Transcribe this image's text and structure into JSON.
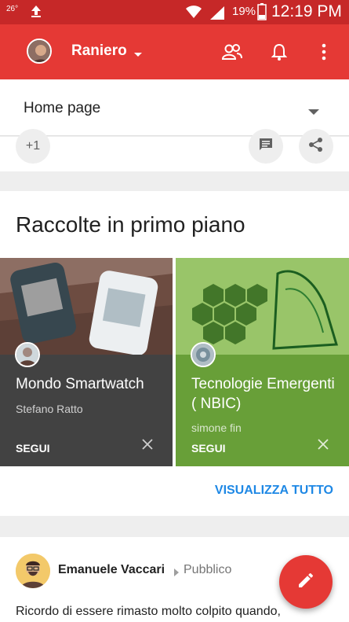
{
  "status_bar": {
    "temperature": "26°",
    "battery": "19%",
    "time": "12:19 PM"
  },
  "app_bar": {
    "account_name": "Raniero",
    "icons": [
      "people-icon",
      "bell-icon",
      "overflow-menu-icon"
    ]
  },
  "page_selector": {
    "label": "Home page"
  },
  "previous_post": {
    "plus_one_label": "+1"
  },
  "collections": {
    "title": "Raccolte in primo piano",
    "items": [
      {
        "name": "Mondo Smartwatch",
        "owner": "Stefano Ratto",
        "follow_label": "SEGUI",
        "color": "#424242"
      },
      {
        "name": "Tecnologie Emergenti ( NBIC)",
        "owner": "simone fin",
        "follow_label": "SEGUI",
        "color": "#689f38"
      }
    ],
    "view_all_label": "VISUALIZZA TUTTO"
  },
  "post": {
    "author": "Emanuele Vaccari",
    "visibility": "Pubblico",
    "text": "Ricordo di essere rimasto molto colpito quando,"
  },
  "colors": {
    "primary": "#e53935",
    "status_bar": "#c62828",
    "accent_link": "#1e88e5"
  }
}
